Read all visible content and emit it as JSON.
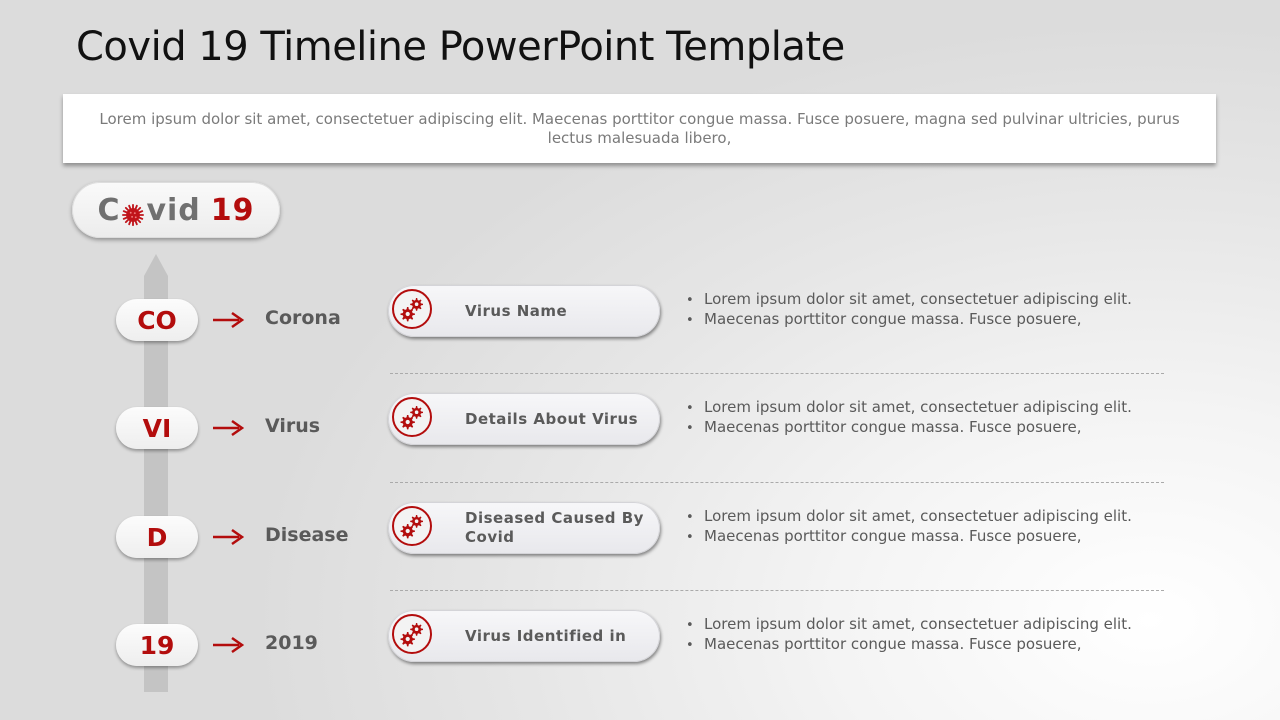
{
  "title": "Covid 19 Timeline PowerPoint Template",
  "intro_text": "Lorem ipsum dolor sit amet, consectetuer adipiscing elit. Maecenas porttitor congue massa. Fusce posuere, magna sed pulvinar ultricies, purus lectus malesuada libero,",
  "brand": {
    "part1": "C",
    "icon": "virus-icon",
    "part2": "vid",
    "number": "19"
  },
  "colors": {
    "accent": "#b30d0d",
    "text": "#5a5a5a",
    "spine": "#c4c4c4"
  },
  "rows": [
    {
      "code": "CO",
      "word": "Corona",
      "label": "Virus Name",
      "icon": "gears-icon",
      "bullets": [
        "Lorem ipsum dolor sit amet, consectetuer adipiscing elit.",
        "Maecenas porttitor congue massa. Fusce posuere,"
      ]
    },
    {
      "code": "VI",
      "word": "Virus",
      "label": "Details About Virus",
      "icon": "gears-icon",
      "bullets": [
        "Lorem ipsum dolor sit amet, consectetuer adipiscing elit.",
        "Maecenas porttitor congue massa. Fusce posuere,"
      ]
    },
    {
      "code": "D",
      "word": "Disease",
      "label": "Diseased Caused By Covid",
      "icon": "gears-icon",
      "bullets": [
        "Lorem ipsum dolor sit amet, consectetuer adipiscing elit.",
        "Maecenas porttitor congue massa. Fusce posuere,"
      ]
    },
    {
      "code": "19",
      "word": "2019",
      "label": "Virus Identified in",
      "icon": "gears-icon",
      "bullets": [
        "Lorem ipsum dolor sit amet, consectetuer adipiscing elit.",
        "Maecenas porttitor congue massa. Fusce posuere,"
      ]
    }
  ]
}
